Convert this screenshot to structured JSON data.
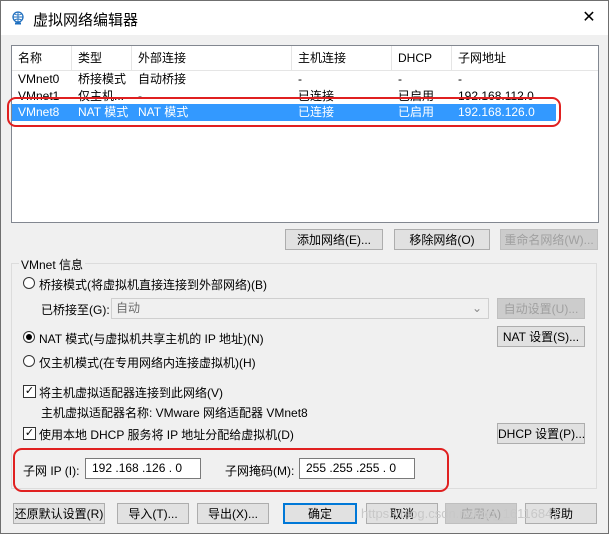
{
  "window": {
    "title": "虚拟网络编辑器",
    "close_glyph": "✕"
  },
  "table": {
    "headers": [
      "名称",
      "类型",
      "外部连接",
      "主机连接",
      "DHCP",
      "子网地址"
    ],
    "rows": [
      [
        "VMnet0",
        "桥接模式",
        "自动桥接",
        "-",
        "-",
        "-"
      ],
      [
        "VMnet1",
        "仅主机...",
        "-",
        "已连接",
        "已启用",
        "192.168.112.0"
      ],
      [
        "VMnet8",
        "NAT 模式",
        "NAT 模式",
        "已连接",
        "已启用",
        "192.168.126.0"
      ]
    ],
    "selected_row": 2
  },
  "table_buttons": {
    "add": "添加网络(E)...",
    "remove": "移除网络(O)",
    "rename": "重命名网络(W)..."
  },
  "vmnet_info": {
    "group_label": "VMnet 信息",
    "bridge_mode": "桥接模式(将虚拟机直接连接到外部网络)(B)",
    "bridged_to_label": "已桥接至(G):",
    "bridged_to_value": "自动",
    "auto_settings": "自动设置(U)...",
    "nat_mode": "NAT 模式(与虚拟机共享主机的 IP 地址)(N)",
    "nat_settings": "NAT 设置(S)...",
    "host_only": "仅主机模式(在专用网络内连接虚拟机)(H)",
    "connect_adapter": "将主机虚拟适配器连接到此网络(V)",
    "adapter_name": "主机虚拟适配器名称: VMware 网络适配器 VMnet8",
    "use_dhcp": "使用本地 DHCP 服务将 IP 地址分配给虚拟机(D)",
    "dhcp_settings": "DHCP 设置(P)...",
    "subnet_ip_label": "子网 IP (I):",
    "subnet_ip": "192 .168 .126 . 0",
    "subnet_mask_label": "子网掩码(M):",
    "subnet_mask": "255 .255 .255 . 0",
    "selected_mode": "nat",
    "connect_adapter_checked": true,
    "use_dhcp_checked": true
  },
  "footer": {
    "restore": "还原默认设置(R)",
    "import": "导入(T)...",
    "export": "导出(X)...",
    "ok": "确定",
    "cancel": "取消",
    "apply": "应用(A)",
    "help": "帮助"
  },
  "watermark": "https://blog.csdn.net/qq_16116847",
  "colors": {
    "selection": "#3399ff",
    "highlight_ring": "#e02020",
    "default_button_border": "#0078d7"
  }
}
